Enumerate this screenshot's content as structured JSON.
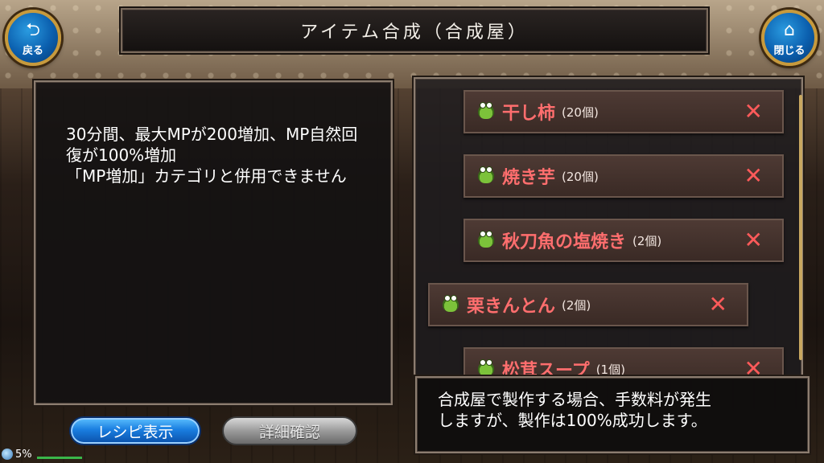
{
  "header": {
    "title": "アイテム合成（合成屋）",
    "back_label": "戻る",
    "close_label": "閉じる"
  },
  "description": {
    "text": "30分間、最大MPが200増加、MP自然回復が100%増加\n「MP増加」カテゴリと併用できません"
  },
  "buttons": {
    "recipe_label": "レシピ表示",
    "detail_label": "詳細確認"
  },
  "ingredients": [
    {
      "name": "干し柿",
      "qty": "(20個)"
    },
    {
      "name": "焼き芋",
      "qty": "(20個)"
    },
    {
      "name": "秋刀魚の塩焼き",
      "qty": "(2個)"
    },
    {
      "name": "栗きんとん",
      "qty": "(2個)"
    },
    {
      "name": "松茸スープ",
      "qty": "(1個)"
    }
  ],
  "info": {
    "text": "合成屋で製作する場合、手数料が発生\nしますが、製作は100%成功します。"
  },
  "status": {
    "percent": "5%"
  },
  "icons": {
    "back": "back-arrow-icon",
    "close": "home-icon",
    "item": "frog-icon",
    "remove": "close-x-icon"
  },
  "colors": {
    "item_name": "#ff6e6e",
    "remove_mark": "#ff5a5a",
    "round_button": "#0b5fae"
  }
}
